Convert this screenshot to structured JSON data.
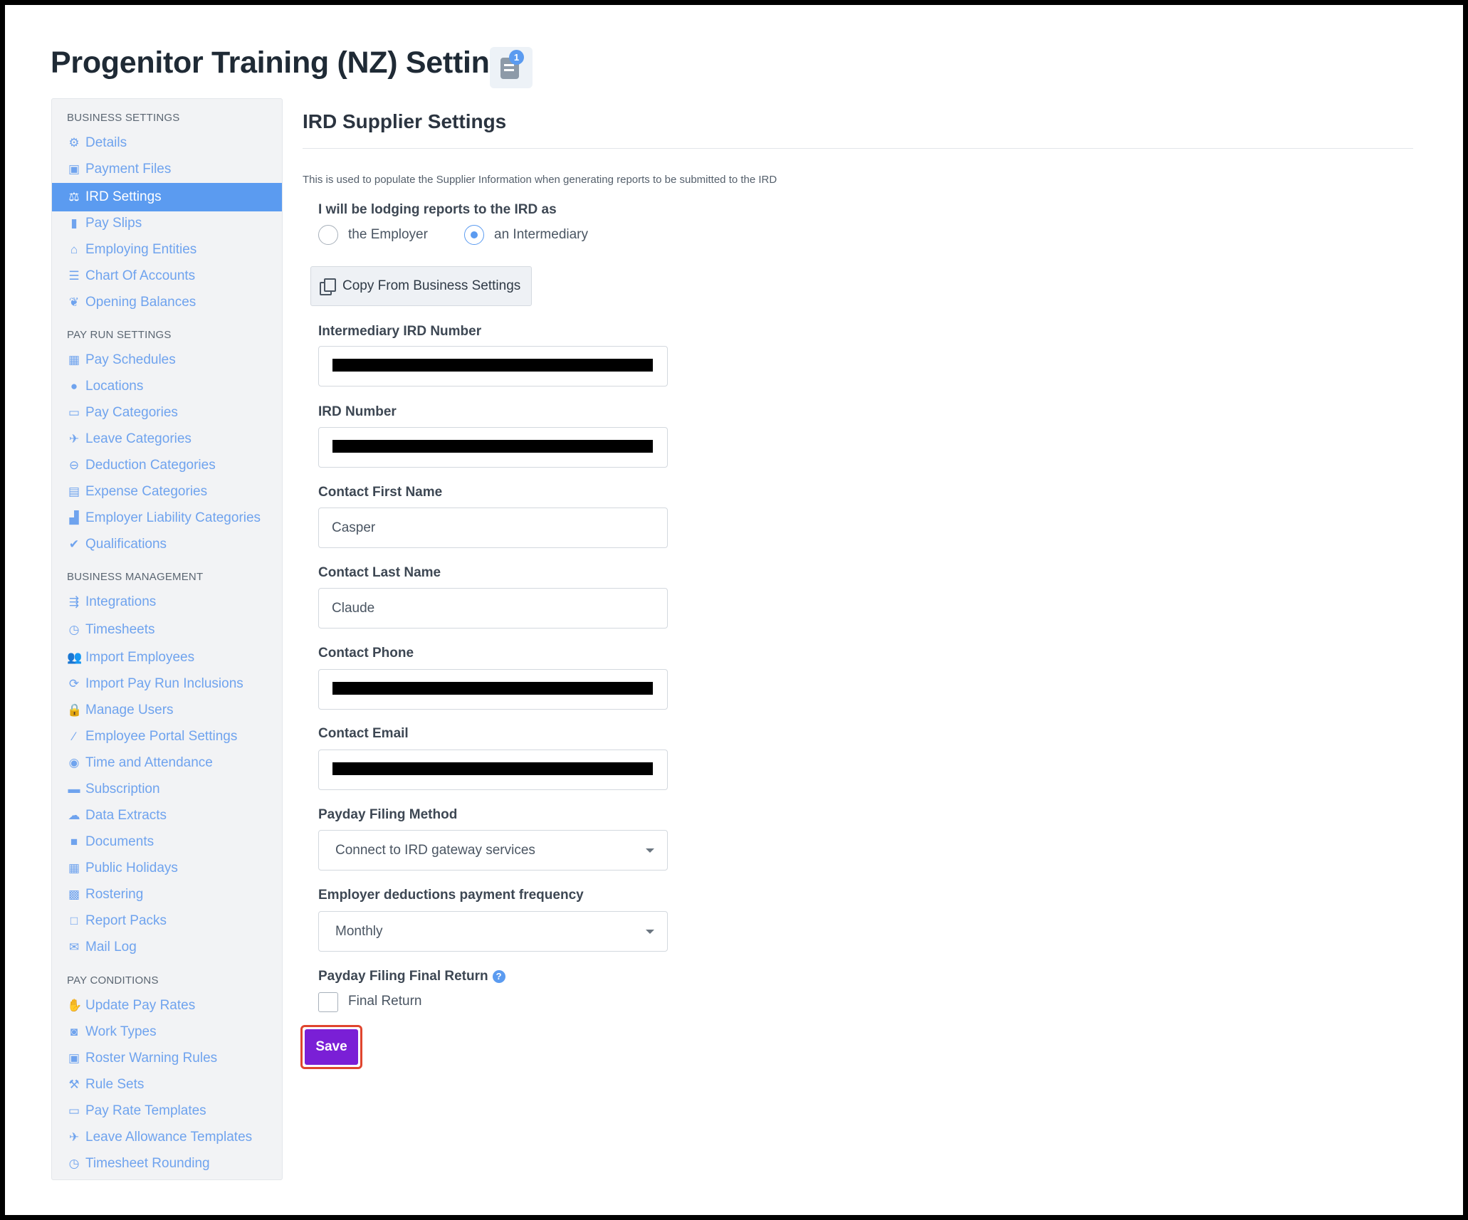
{
  "page": {
    "title": "Progenitor Training (NZ) Settings",
    "notification_count": "1"
  },
  "sidebar": {
    "sections": [
      {
        "heading": "BUSINESS SETTINGS",
        "items": [
          {
            "label": "Details",
            "icon": "gear-icon"
          },
          {
            "label": "Payment Files",
            "icon": "floppy-icon"
          },
          {
            "label": "IRD Settings",
            "icon": "balance-scale-icon",
            "active": true
          },
          {
            "label": "Pay Slips",
            "icon": "file-icon"
          },
          {
            "label": "Employing Entities",
            "icon": "bank-icon"
          },
          {
            "label": "Chart Of Accounts",
            "icon": "list-icon"
          },
          {
            "label": "Opening Balances",
            "icon": "leaf-icon"
          }
        ]
      },
      {
        "heading": "PAY RUN SETTINGS",
        "items": [
          {
            "label": "Pay Schedules",
            "icon": "calendar-icon"
          },
          {
            "label": "Locations",
            "icon": "globe-icon"
          },
          {
            "label": "Pay Categories",
            "icon": "money-icon"
          },
          {
            "label": "Leave Categories",
            "icon": "plane-icon"
          },
          {
            "label": "Deduction Categories",
            "icon": "minus-circle-icon"
          },
          {
            "label": "Expense Categories",
            "icon": "archive-icon"
          },
          {
            "label": "Employer Liability Categories",
            "icon": "industry-icon"
          },
          {
            "label": "Qualifications",
            "icon": "check-icon"
          }
        ]
      },
      {
        "heading": "BUSINESS MANAGEMENT",
        "items": [
          {
            "label": "Integrations",
            "icon": "integration-icon"
          },
          {
            "label": "Timesheets",
            "icon": "clock-icon"
          },
          {
            "label": "Import Employees",
            "icon": "people-icon"
          },
          {
            "label": "Import Pay Run Inclusions",
            "icon": "refresh-icon"
          },
          {
            "label": "Manage Users",
            "icon": "lock-icon"
          },
          {
            "label": "Employee Portal Settings",
            "icon": "magic-wand-icon"
          },
          {
            "label": "Time and Attendance",
            "icon": "time-attendance-icon"
          },
          {
            "label": "Subscription",
            "icon": "credit-card-icon"
          },
          {
            "label": "Data Extracts",
            "icon": "cloud-download-icon"
          },
          {
            "label": "Documents",
            "icon": "folder-icon"
          },
          {
            "label": "Public Holidays",
            "icon": "calendar-icon"
          },
          {
            "label": "Rostering",
            "icon": "calendar-grid-icon"
          },
          {
            "label": "Report Packs",
            "icon": "folder-open-icon"
          },
          {
            "label": "Mail Log",
            "icon": "envelope-icon"
          }
        ]
      },
      {
        "heading": "PAY CONDITIONS",
        "items": [
          {
            "label": "Update Pay Rates",
            "icon": "hand-money-icon"
          },
          {
            "label": "Work Types",
            "icon": "camera-icon"
          },
          {
            "label": "Roster Warning Rules",
            "icon": "calendar-alert-icon"
          },
          {
            "label": "Rule Sets",
            "icon": "gavel-icon"
          },
          {
            "label": "Pay Rate Templates",
            "icon": "money-icon"
          },
          {
            "label": "Leave Allowance Templates",
            "icon": "plane-icon"
          },
          {
            "label": "Timesheet Rounding",
            "icon": "clock-icon"
          }
        ]
      }
    ]
  },
  "main": {
    "title": "IRD Supplier Settings",
    "description": "This is used to populate the Supplier Information when generating reports to be submitted to the IRD",
    "lodging_label": "I will be lodging reports to the IRD as",
    "radio_employer": "the Employer",
    "radio_intermediary": "an Intermediary",
    "selected_role": "an Intermediary",
    "copy_button": "Copy From Business Settings",
    "fields": {
      "intermediary_ird_label": "Intermediary IRD Number",
      "ird_number_label": "IRD Number",
      "first_name_label": "Contact First Name",
      "first_name_value": "Casper",
      "last_name_label": "Contact Last Name",
      "last_name_value": "Claude",
      "phone_label": "Contact Phone",
      "email_label": "Contact Email",
      "filing_method_label": "Payday Filing Method",
      "filing_method_value": "Connect to IRD gateway services",
      "frequency_label": "Employer deductions payment frequency",
      "frequency_value": "Monthly",
      "final_return_label": "Payday Filing Final Return",
      "final_return_checkbox": "Final Return"
    },
    "save_button": "Save"
  },
  "colors": {
    "accent": "#5b9bf0",
    "nav_link": "#6fa3ee",
    "save_button": "#7a1fd6",
    "highlight_border": "#e0452e"
  }
}
